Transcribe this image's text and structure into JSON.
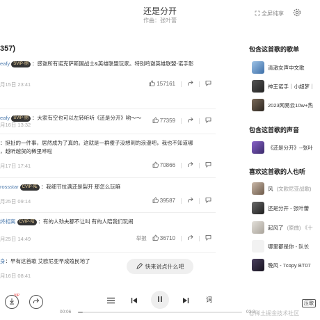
{
  "header": {
    "title": "还是分开",
    "artist_line": "作曲：张叶蕾",
    "share_label": "全屏纯享"
  },
  "comments_header": "357)",
  "comments": [
    {
      "user": "eafy",
      "badge": "SVIP·捌",
      "text": "：感谢所有诺克萨斯国战士&英雄联盟玩家。特别鸣谢英雄联盟-诺手影",
      "text2": "",
      "time": "月15日 23:41",
      "likes": "157161",
      "report": ""
    },
    {
      "user": "eafy",
      "badge": "SVIP·捌",
      "text": "：大家有空也可以左转听听《还是分开》哟～～",
      "text2": "",
      "time": "月16日 13:32",
      "likes": "77359",
      "report": ""
    },
    {
      "user": "",
      "badge": "",
      "text": "：挺扯的一件事，居然成为了真的。这就是一群傻子没想到的浪漫吧，我也不知道哪",
      "text2": "，越听越贸的稀里哗啦",
      "time": "月17日 17:41",
      "likes": "70866",
      "report": ""
    },
    {
      "user": "rossstar",
      "badge": "CVIP·陆",
      "text": "：我细节拉满还是裂开 那怎么玩嘛",
      "text2": "",
      "time": "月25日 09:14",
      "likes": "39587",
      "report": ""
    },
    {
      "user": "终相离",
      "badge": "CVIP·陆",
      "text": "：有的人劲夫都不让叫 有的人陪我们玩闹",
      "text2": "",
      "time": "月25日 14:49",
      "likes": "36710",
      "report": "举报"
    },
    {
      "user": "身",
      "badge": "",
      "text": "：早有这首歌 艾欧尼亚早成殖民地了",
      "text2": "",
      "time": "月16日 08:41",
      "likes": "",
      "report": ""
    }
  ],
  "right_panel": {
    "playlists_title": "包含这首歌的歌单",
    "playlists": [
      {
        "name": "清澈女声中文歌",
        "icon": "playlist-thumb"
      },
      {
        "name": "神王诺手｜小超梦｜",
        "icon": "playlist-thumb"
      },
      {
        "name": "2023网易云10w+热",
        "icon": "playlist-thumb"
      }
    ],
    "voices_title": "包含这首歌的声音",
    "voices": [
      {
        "name": "《还是分开》--张叶",
        "icon": "voice-thumb"
      }
    ],
    "likers_title": "喜欢这首歌的人也听",
    "similar": [
      {
        "name": "风",
        "extra": "(文欧尼亚战歌)"
      },
      {
        "name": "还是分开 - 张叶蕾",
        "extra": ""
      },
      {
        "name": "起风了",
        "extra": "(原曲) 《十"
      },
      {
        "name": "哪里都是你 - 队长",
        "extra": ""
      },
      {
        "name": "晚风 - 7copy BT07",
        "extra": ""
      }
    ]
  },
  "float_input": "快来说点什么吧",
  "player": {
    "current_time": "00:06",
    "total_time": "03:3",
    "progress_fraction": 0.03,
    "lyric_label": "词",
    "mini_lyric_label": "压歌",
    "vip_label": "VIP"
  },
  "watermark": "@稀土掘金技术社区",
  "colors": {
    "accent_user": "#507daf",
    "badge_bg": "#333333",
    "badge_text": "#f1d6a0"
  }
}
